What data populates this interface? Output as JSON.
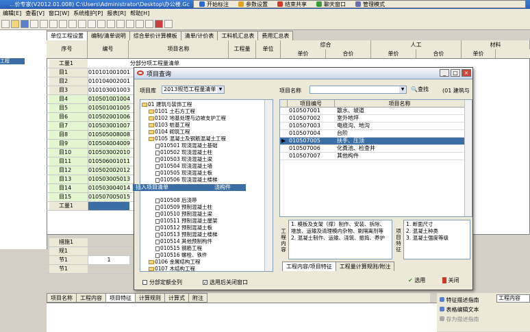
{
  "window": {
    "title": "...价专家(V2012.01.008) C:\\Users\\Administrator\\Desktop\\办公楼.Gc"
  },
  "floatbar": {
    "items": [
      "开始标注",
      "参数设置",
      "结束共享",
      "聊天窗口",
      "管理模式"
    ]
  },
  "menu": [
    "编辑[E]",
    "查看[V]",
    "窗口[W]",
    "系统维护[P]",
    "报表[R]",
    "帮助[H]"
  ],
  "tabs": [
    "单位工程设置",
    "编制/清单说明",
    "综合单价计算模板",
    "清单/计价表",
    "工料机汇总表",
    "费用汇总表"
  ],
  "left_pane": {
    "item": "工程"
  },
  "grid": {
    "headers": {
      "seq": "序号",
      "code": "编号",
      "name": "项目名称",
      "qty": "工程量",
      "unit": "单位",
      "comp": "综合",
      "labor": "人工",
      "mat": "材料",
      "unit_price": "单价",
      "total_price": "合价"
    },
    "section_title": "分部分项工程量清单",
    "rows": [
      {
        "seq": "工量1",
        "code": ""
      },
      {
        "seq": "目1",
        "code": "010101001001"
      },
      {
        "seq": "目2",
        "code": "010104002001"
      },
      {
        "seq": "目3",
        "code": "010103001003"
      },
      {
        "seq": "目4",
        "code": "010501001004"
      },
      {
        "seq": "目5",
        "code": "010501001005"
      },
      {
        "seq": "目6",
        "code": "010502001006"
      },
      {
        "seq": "目7",
        "code": "010503001007"
      },
      {
        "seq": "目8",
        "code": "010505008008"
      },
      {
        "seq": "目9",
        "code": "010504004009"
      },
      {
        "seq": "目10",
        "code": "010503002010"
      },
      {
        "seq": "目11",
        "code": "010506001011"
      },
      {
        "seq": "目12",
        "code": "010502002012"
      },
      {
        "seq": "目13",
        "code": "010503005013"
      },
      {
        "seq": "目14",
        "code": "010503004014"
      },
      {
        "seq": "目15",
        "code": "010507005015"
      },
      {
        "seq": "工量1",
        "code": ""
      }
    ],
    "measures": [
      {
        "seq": "措施1",
        "code": ""
      },
      {
        "seq": "规1",
        "code": ""
      },
      {
        "seq": "节1",
        "code": "1"
      },
      {
        "seq": "节1",
        "code": ""
      }
    ]
  },
  "bottom_tabs": [
    "项目名称",
    "工程内容",
    "项目特征",
    "计算规则",
    "计算式",
    "附注"
  ],
  "side_panel": {
    "btn1": "特征描述指南",
    "btn2": "表格编辑文本",
    "btn3": "存为描述指南",
    "header": "工程内容"
  },
  "dialog": {
    "title": "项目查询",
    "lib_label": "项目库",
    "lib_value": "2013规范工程量清单",
    "name_label": "项目名称",
    "search_label": "查找",
    "right_top_label": "(01 建筑与",
    "context_item": "插入项目清单",
    "context_item2": "浇构件",
    "tree": [
      {
        "level": 0,
        "icon": "folder",
        "text": "01  建筑与装饰工程"
      },
      {
        "level": 1,
        "icon": "folder",
        "text": "0101  土石方工程"
      },
      {
        "level": 1,
        "icon": "folder",
        "text": "0102  地基处理与边坡支护工程"
      },
      {
        "level": 1,
        "icon": "folder",
        "text": "0103  桩基工程"
      },
      {
        "level": 1,
        "icon": "folder",
        "text": "0104  砌筑工程"
      },
      {
        "level": 1,
        "icon": "folder",
        "text": "0105  混凝土及钢筋混凝土工程"
      },
      {
        "level": 2,
        "icon": "doc",
        "text": "010501  现浇混凝土基础"
      },
      {
        "level": 2,
        "icon": "doc",
        "text": "010502  现浇混凝土柱"
      },
      {
        "level": 2,
        "icon": "doc",
        "text": "010503  现浇混凝土梁"
      },
      {
        "level": 2,
        "icon": "doc",
        "text": "010504  现浇混凝土墙"
      },
      {
        "level": 2,
        "icon": "doc",
        "text": "010505  现浇混凝土板"
      },
      {
        "level": 2,
        "icon": "doc",
        "text": "010506  现浇混凝土楼梯"
      },
      {
        "level": 2,
        "icon": "doc",
        "text": ""
      },
      {
        "level": 2,
        "icon": "doc",
        "text": "010508  后浇带"
      },
      {
        "level": 2,
        "icon": "doc",
        "text": "010509  预制混凝土柱"
      },
      {
        "level": 2,
        "icon": "doc",
        "text": "010510  预制混凝土梁"
      },
      {
        "level": 2,
        "icon": "doc",
        "text": "010511  预制混凝土屋架"
      },
      {
        "level": 2,
        "icon": "doc",
        "text": "010512  预制混凝土板"
      },
      {
        "level": 2,
        "icon": "doc",
        "text": "010513  预制混凝土楼梯"
      },
      {
        "level": 2,
        "icon": "doc",
        "text": "010514  其他预制构件"
      },
      {
        "level": 2,
        "icon": "doc",
        "text": "010515  钢筋工程"
      },
      {
        "level": 2,
        "icon": "doc",
        "text": "010516  螺栓、铁件"
      },
      {
        "level": 1,
        "icon": "folder",
        "text": "0106  金属结构工程"
      },
      {
        "level": 1,
        "icon": "folder",
        "text": "0107  木结构工程"
      }
    ],
    "table": {
      "col_code": "项目编号",
      "col_name": "项目名称",
      "rows": [
        {
          "code": "010507001",
          "name": "散水、坡道"
        },
        {
          "code": "010507002",
          "name": "室外地坪"
        },
        {
          "code": "010507003",
          "name": "电缆沟、地沟"
        },
        {
          "code": "010507004",
          "name": "台阶"
        },
        {
          "code": "010507005",
          "name": "扶手、压顶"
        },
        {
          "code": "010507006",
          "name": "化粪池、检查井"
        },
        {
          "code": "010507007",
          "name": "其他构件"
        }
      ]
    },
    "content_label": "工程内容",
    "content_text": "1. 模板及支架（撑）制作、安装、拆除、堆放、运输及清理模内杂物、刷隔离剂等\n2. 混凝土制作、运输、浇筑、振捣、养护",
    "feature_label": "项目特征",
    "feature_text": "1. 断面尺寸\n2. 混凝土种类\n3. 混凝土强度等级",
    "lower_tabs": [
      "工程内容/项目特征",
      "工程量计算规则/附注"
    ],
    "cb1": "分部定额全列",
    "cb2": "选用后关闭窗口",
    "select_btn": "选用",
    "close_btn": "关闭"
  }
}
